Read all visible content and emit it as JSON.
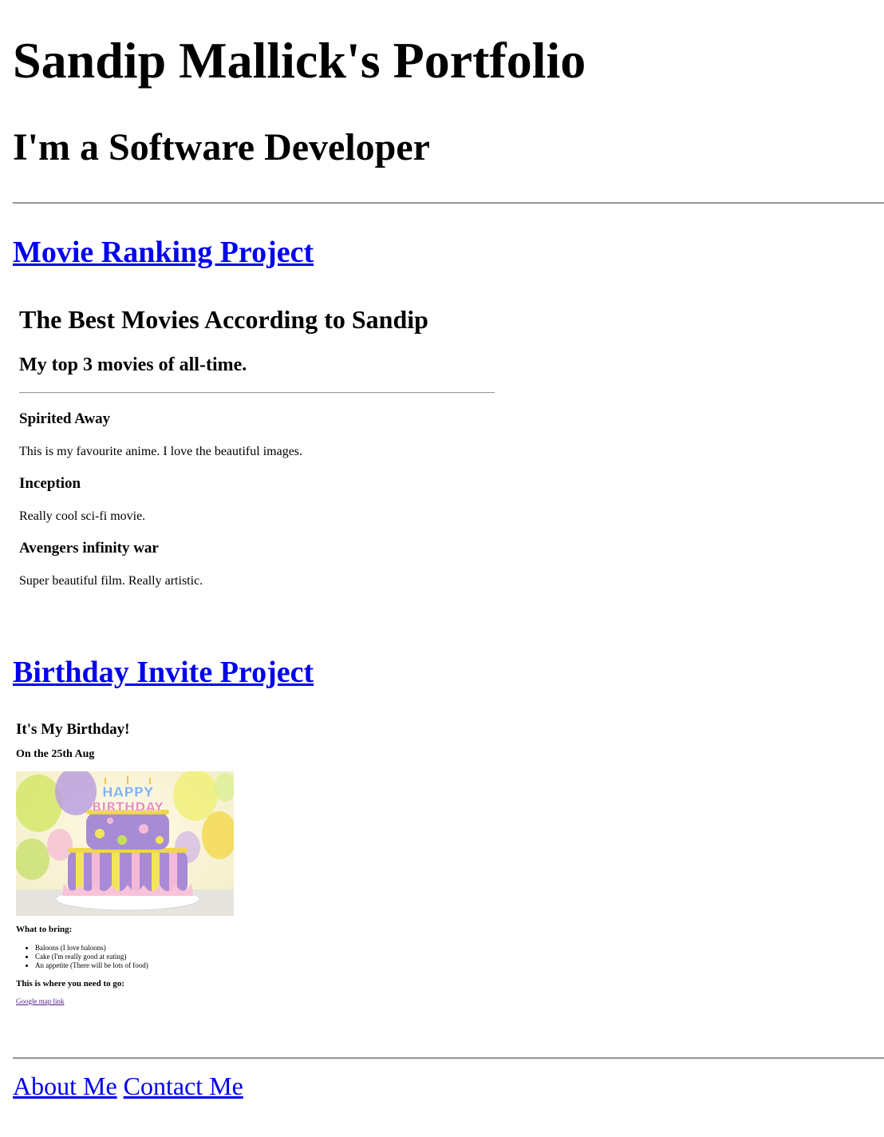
{
  "header": {
    "title": "Sandip Mallick's Portfolio",
    "subtitle": "I'm a Software Developer"
  },
  "projects": [
    {
      "link_text": "Movie Ranking Project",
      "embed": {
        "title": "The Best Movies According to Sandip",
        "subtitle": "My top 3 movies of all-time.",
        "movies": [
          {
            "title": "Spirited Away",
            "description": "This is my favourite anime. I love the beautiful images."
          },
          {
            "title": "Inception",
            "description": "Really cool sci-fi movie."
          },
          {
            "title": "Avengers infinity war",
            "description": "Super beautiful film. Really artistic."
          }
        ]
      }
    },
    {
      "link_text": "Birthday Invite Project",
      "embed": {
        "title": "It's My Birthday!",
        "date": "On the 25th Aug",
        "image_alt": "HAPPY BIRTHDAY",
        "bring_heading": "What to bring:",
        "bring_items": [
          "Baloons (I love baloons)",
          "Cake (I'm really good at eating)",
          "An appetite (There will be lots of food)"
        ],
        "go_heading": "This is where you need to go:",
        "map_link": "Google map link"
      }
    }
  ],
  "footer": {
    "about": "About Me",
    "contact": "Contact Me"
  },
  "colors": {
    "link": "#0000ee",
    "visited_link": "#551a8b",
    "rule": "#9a9a9a"
  }
}
